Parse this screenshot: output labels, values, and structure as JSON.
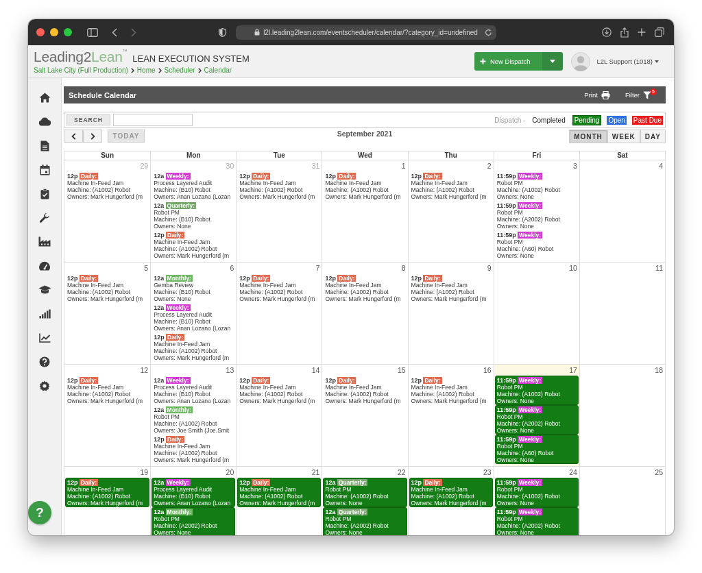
{
  "browser": {
    "url": "l2l.leading2lean.com/eventscheduler/calendar/?category_id=undefined"
  },
  "header": {
    "logo_main": "Leading2",
    "logo_accent": "Lean",
    "logo_mark": "™",
    "system": "LEAN EXECUTION SYSTEM",
    "breadcrumbs": [
      "Salt Lake City (Full Production)",
      "Home",
      "Scheduler",
      "Calendar"
    ],
    "new_button": "New Dispatch",
    "user": "L2L Support (1018)"
  },
  "panel": {
    "title": "Schedule Calendar",
    "print": "Print",
    "filter": "Filter",
    "filter_count": "5"
  },
  "search": {
    "button": "SEARCH",
    "legend_label": "Dispatch -",
    "legend": [
      {
        "label": "Completed",
        "kind": "completed"
      },
      {
        "label": "Pending",
        "kind": "pending"
      },
      {
        "label": "Open",
        "kind": "open"
      },
      {
        "label": "Past Due",
        "kind": "past_due"
      }
    ]
  },
  "nav": {
    "today": {
      "label": "TODAY",
      "disabled": true
    },
    "title": "September 2021",
    "views": [
      {
        "label": "MONTH",
        "selected": true
      },
      {
        "label": "WEEK",
        "selected": false
      },
      {
        "label": "DAY",
        "selected": false
      }
    ]
  },
  "weekdays": [
    "Sun",
    "Mon",
    "Tue",
    "Wed",
    "Thu",
    "Fri",
    "Sat"
  ],
  "weeks": [
    {
      "days": [
        {
          "date": "29",
          "other_month": true,
          "today": false,
          "events": [
            {
              "time": "12p",
              "freq": "Daily:",
              "color": "#e0694e",
              "title": "Machine In-Feed Jam",
              "machine": "Machine: (A1002) Robot",
              "owners": "Owners: Mark Hungerford (m",
              "pending": false
            }
          ]
        },
        {
          "date": "30",
          "other_month": true,
          "today": false,
          "events": [
            {
              "time": "12a",
              "freq": "Weekly:",
              "color": "#d63ad6",
              "title": "Process Layered Audit",
              "machine": "Machine: (B10) Robot",
              "owners": "Owners: Anan Lozano (Lozan",
              "pending": false
            },
            {
              "time": "12a",
              "freq": "Quarterly:",
              "color": "#72a866",
              "title": "Robot PM",
              "machine": "Machine: (B10) Robot",
              "owners": "Owners: None",
              "pending": false
            },
            {
              "time": "12p",
              "freq": "Daily:",
              "color": "#e0694e",
              "title": "Machine In-Feed Jam",
              "machine": "Machine: (A1002) Robot",
              "owners": "Owners: Mark Hungerford (m",
              "pending": false
            }
          ]
        },
        {
          "date": "31",
          "other_month": true,
          "today": false,
          "events": [
            {
              "time": "12p",
              "freq": "Daily:",
              "color": "#e0694e",
              "title": "Machine In-Feed Jam",
              "machine": "Machine: (A1002) Robot",
              "owners": "Owners: Mark Hungerford (m",
              "pending": false
            }
          ]
        },
        {
          "date": "1",
          "other_month": false,
          "today": false,
          "events": [
            {
              "time": "12p",
              "freq": "Daily:",
              "color": "#e0694e",
              "title": "Machine In-Feed Jam",
              "machine": "Machine: (A1002) Robot",
              "owners": "Owners: Mark Hungerford (m",
              "pending": false
            }
          ]
        },
        {
          "date": "2",
          "other_month": false,
          "today": false,
          "events": [
            {
              "time": "12p",
              "freq": "Daily:",
              "color": "#e0694e",
              "title": "Machine In-Feed Jam",
              "machine": "Machine: (A1002) Robot",
              "owners": "Owners: Mark Hungerford (m",
              "pending": false
            }
          ]
        },
        {
          "date": "3",
          "other_month": false,
          "today": false,
          "events": [
            {
              "time": "11:59p",
              "freq": "Weekly:",
              "color": "#d63ad6",
              "title": "Robot PM",
              "machine": "Machine: (A1002) Robot",
              "owners": "Owners: None",
              "pending": false
            },
            {
              "time": "11:59p",
              "freq": "Weekly:",
              "color": "#d63ad6",
              "title": "Robot PM",
              "machine": "Machine: (A2002) Robot",
              "owners": "Owners: None",
              "pending": false
            },
            {
              "time": "11:59p",
              "freq": "Weekly:",
              "color": "#d63ad6",
              "title": "Robot PM",
              "machine": "Machine: (A60) Robot",
              "owners": "Owners: None",
              "pending": false
            }
          ]
        },
        {
          "date": "4",
          "other_month": false,
          "today": false
        }
      ]
    },
    {
      "days": [
        {
          "date": "5",
          "other_month": false,
          "today": false,
          "events": [
            {
              "time": "12p",
              "freq": "Daily:",
              "color": "#e0694e",
              "title": "Machine In-Feed Jam",
              "machine": "Machine: (A1002) Robot",
              "owners": "Owners: Mark Hungerford (m",
              "pending": false
            }
          ]
        },
        {
          "date": "6",
          "other_month": false,
          "today": false,
          "events": [
            {
              "time": "12a",
              "freq": "Monthly:",
              "color": "#6fb863",
              "title": "Gemba Review",
              "machine": "Machine: (B10) Robot",
              "owners": "Owners: None",
              "pending": false
            },
            {
              "time": "12a",
              "freq": "Weekly:",
              "color": "#d63ad6",
              "title": "Process Layered Audit",
              "machine": "Machine: (B10) Robot",
              "owners": "Owners: Anan Lozano (Lozan",
              "pending": false
            },
            {
              "time": "12p",
              "freq": "Daily:",
              "color": "#e0694e",
              "title": "Machine In-Feed Jam",
              "machine": "Machine: (A1002) Robot",
              "owners": "Owners: Mark Hungerford (m",
              "pending": false
            }
          ]
        },
        {
          "date": "7",
          "other_month": false,
          "today": false,
          "events": [
            {
              "time": "12p",
              "freq": "Daily:",
              "color": "#e0694e",
              "title": "Machine In-Feed Jam",
              "machine": "Machine: (A1002) Robot",
              "owners": "Owners: Mark Hungerford (m",
              "pending": false
            }
          ]
        },
        {
          "date": "8",
          "other_month": false,
          "today": false,
          "events": [
            {
              "time": "12p",
              "freq": "Daily:",
              "color": "#e0694e",
              "title": "Machine In-Feed Jam",
              "machine": "Machine: (A1002) Robot",
              "owners": "Owners: Mark Hungerford (m",
              "pending": false
            }
          ]
        },
        {
          "date": "9",
          "other_month": false,
          "today": false,
          "events": [
            {
              "time": "12p",
              "freq": "Daily:",
              "color": "#e0694e",
              "title": "Machine In-Feed Jam",
              "machine": "Machine: (A1002) Robot",
              "owners": "Owners: Mark Hungerford (m",
              "pending": false
            }
          ]
        },
        {
          "date": "10",
          "other_month": false,
          "today": false
        },
        {
          "date": "11",
          "other_month": false,
          "today": false
        }
      ]
    },
    {
      "days": [
        {
          "date": "12",
          "other_month": false,
          "today": false,
          "events": [
            {
              "time": "12p",
              "freq": "Daily:",
              "color": "#e0694e",
              "title": "Machine In-Feed Jam",
              "machine": "Machine: (A1002) Robot",
              "owners": "Owners: Mark Hungerford (m",
              "pending": false
            }
          ]
        },
        {
          "date": "13",
          "other_month": false,
          "today": false,
          "events": [
            {
              "time": "12a",
              "freq": "Weekly:",
              "color": "#d63ad6",
              "title": "Process Layered Audit",
              "machine": "Machine: (B10) Robot",
              "owners": "Owners: Anan Lozano (Lozan",
              "pending": false
            },
            {
              "time": "12a",
              "freq": "Monthly:",
              "color": "#6fb863",
              "title": "Robot PM",
              "machine": "Machine: (A1002) Robot",
              "owners": "Owners: Joe Smith (Joe.Smit",
              "pending": false
            },
            {
              "time": "12p",
              "freq": "Daily:",
              "color": "#e0694e",
              "title": "Machine In-Feed Jam",
              "machine": "Machine: (A1002) Robot",
              "owners": "Owners: Mark Hungerford (m",
              "pending": false
            }
          ]
        },
        {
          "date": "14",
          "other_month": false,
          "today": false,
          "events": [
            {
              "time": "12p",
              "freq": "Daily:",
              "color": "#e0694e",
              "title": "Machine In-Feed Jam",
              "machine": "Machine: (A1002) Robot",
              "owners": "Owners: Mark Hungerford (m",
              "pending": false
            }
          ]
        },
        {
          "date": "15",
          "other_month": false,
          "today": false,
          "events": [
            {
              "time": "12p",
              "freq": "Daily:",
              "color": "#e0694e",
              "title": "Machine In-Feed Jam",
              "machine": "Machine: (A1002) Robot",
              "owners": "Owners: Mark Hungerford (m",
              "pending": false
            }
          ]
        },
        {
          "date": "16",
          "other_month": false,
          "today": false,
          "events": [
            {
              "time": "12p",
              "freq": "Daily:",
              "color": "#e0694e",
              "title": "Machine In-Feed Jam",
              "machine": "Machine: (A1002) Robot",
              "owners": "Owners: Mark Hungerford (m",
              "pending": false
            }
          ]
        },
        {
          "date": "17",
          "other_month": false,
          "today": true,
          "events": [
            {
              "time": "11:59p",
              "freq": "Weekly:",
              "color": "#d63ad6",
              "title": "Robot PM",
              "machine": "Machine: (A1002) Robot",
              "owners": "Owners: None",
              "pending": true
            },
            {
              "time": "11:59p",
              "freq": "Weekly:",
              "color": "#d63ad6",
              "title": "Robot PM",
              "machine": "Machine: (A2002) Robot",
              "owners": "Owners: None",
              "pending": true
            },
            {
              "time": "11:59p",
              "freq": "Weekly:",
              "color": "#d63ad6",
              "title": "Robot PM",
              "machine": "Machine: (A60) Robot",
              "owners": "Owners: None",
              "pending": true
            }
          ]
        },
        {
          "date": "18",
          "other_month": false,
          "today": false
        }
      ]
    },
    {
      "days": [
        {
          "date": "19",
          "other_month": false,
          "today": false,
          "events": [
            {
              "time": "12p",
              "freq": "Daily:",
              "color": "#e0694e",
              "title": "Machine In-Feed Jam",
              "machine": "Machine: (A1002) Robot",
              "owners": "Owners: Mark Hungerford (m",
              "pending": true
            }
          ]
        },
        {
          "date": "20",
          "other_month": false,
          "today": false,
          "events": [
            {
              "time": "12a",
              "freq": "Weekly:",
              "color": "#d63ad6",
              "title": "Process Layered Audit",
              "machine": "Machine: (B10) Robot",
              "owners": "Owners: Anan Lozano (Lozan",
              "pending": true
            },
            {
              "time": "12a",
              "freq": "Monthly:",
              "color": "#6fb863",
              "title": "Robot PM",
              "machine": "Machine: (A2002) Robot",
              "owners": "Owners: None",
              "pending": true
            }
          ]
        },
        {
          "date": "21",
          "other_month": false,
          "today": false,
          "events": [
            {
              "time": "12p",
              "freq": "Daily:",
              "color": "#e0694e",
              "title": "Machine In-Feed Jam",
              "machine": "Machine: (A1002) Robot",
              "owners": "Owners: Mark Hungerford (m",
              "pending": true
            }
          ]
        },
        {
          "date": "22",
          "other_month": false,
          "today": false,
          "events": [
            {
              "time": "12a",
              "freq": "Quarterly:",
              "color": "#7fa774",
              "title": "Robot PM",
              "machine": "Machine: (A1002) Robot",
              "owners": "Owners: None",
              "pending": true
            },
            {
              "time": "12a",
              "freq": "Quarterly:",
              "color": "#7fa774",
              "title": "Robot PM",
              "machine": "Machine: (A2002) Robot",
              "owners": "Owners: None",
              "pending": true
            }
          ]
        },
        {
          "date": "23",
          "other_month": false,
          "today": false,
          "events": [
            {
              "time": "12p",
              "freq": "Daily:",
              "color": "#e0694e",
              "title": "Machine In-Feed Jam",
              "machine": "Machine: (A1002) Robot",
              "owners": "Owners: Mark Hungerford (m",
              "pending": true
            }
          ]
        },
        {
          "date": "24",
          "other_month": false,
          "today": false,
          "events": [
            {
              "time": "11:59p",
              "freq": "Weekly:",
              "color": "#d63ad6",
              "title": "Robot PM",
              "machine": "Machine: (A1002) Robot",
              "owners": "Owners: None",
              "pending": true
            },
            {
              "time": "11:59p",
              "freq": "Weekly:",
              "color": "#d63ad6",
              "title": "Robot PM",
              "machine": "Machine: (A2002) Robot",
              "owners": "Owners: None",
              "pending": true
            }
          ]
        },
        {
          "date": "25",
          "other_month": false,
          "today": false
        }
      ]
    }
  ],
  "help": "?"
}
